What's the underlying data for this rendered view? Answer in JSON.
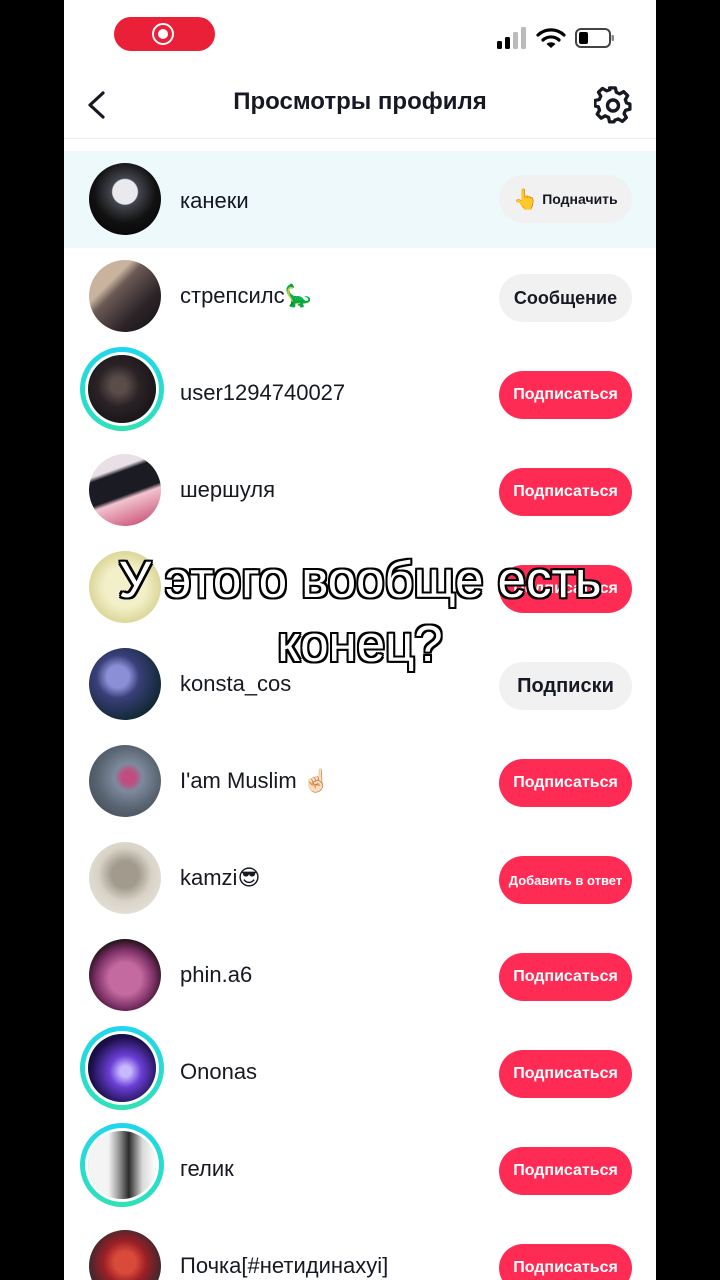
{
  "header": {
    "title": "Просмотры профиля"
  },
  "caption": {
    "line1": "У этого вообще есть",
    "line2": "конец?"
  },
  "rows": [
    {
      "username": "канеки",
      "button": "Подначить",
      "button_icon": "👆"
    },
    {
      "username": "стрепсилс🦕",
      "button": "Сообщение"
    },
    {
      "username": "user1294740027",
      "button": "Подписаться"
    },
    {
      "username": "шершуля",
      "button": "Подписаться"
    },
    {
      "username": "",
      "button": "Подписаться"
    },
    {
      "username": "konsta_cos",
      "button": "Подписки"
    },
    {
      "username": "I'am Muslim ☝🏻",
      "button": "Подписаться"
    },
    {
      "username": "kamzi😎",
      "button": "Добавить в ответ"
    },
    {
      "username": "phin.a6",
      "button": "Подписаться"
    },
    {
      "username": "Ononas",
      "button": "Подписаться"
    },
    {
      "username": "гелик",
      "button": "Подписаться"
    },
    {
      "username": "Почка[#нетидинахуi]",
      "button": "Подписаться"
    }
  ],
  "colors": {
    "accent": "#fe2c55",
    "recording": "#ea1f38",
    "story_ring": "#1fd5f1"
  }
}
